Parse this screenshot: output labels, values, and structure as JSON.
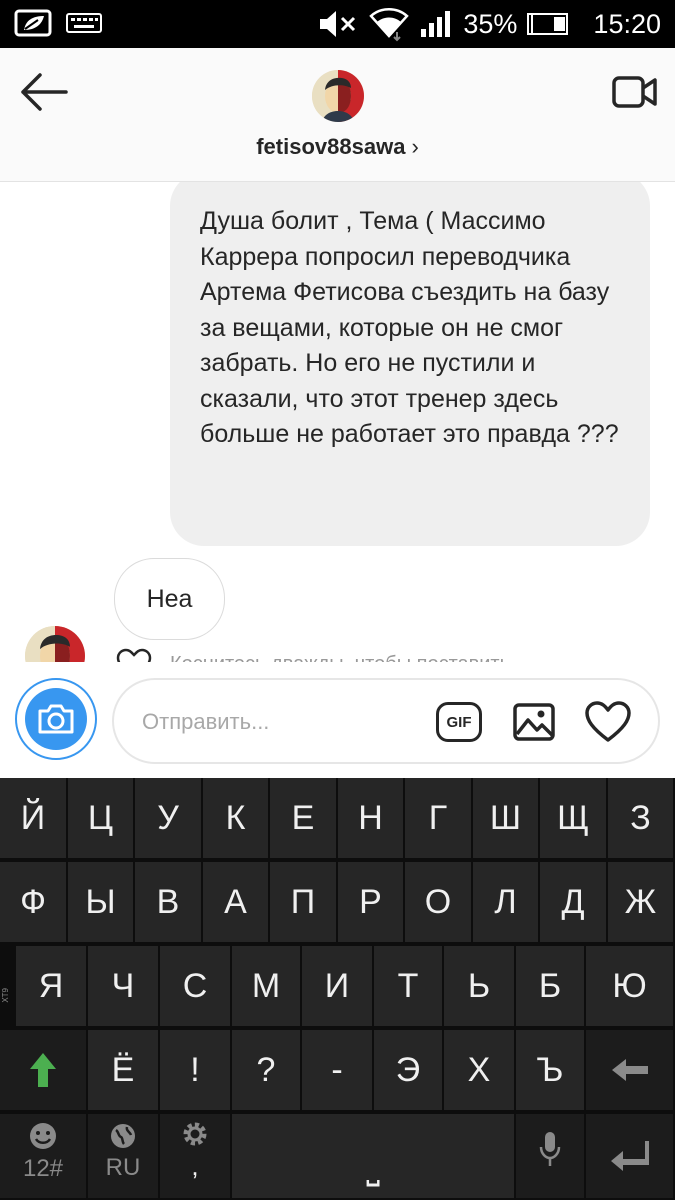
{
  "status_bar": {
    "battery_percent": "35%",
    "time": "15:20",
    "icons": [
      "leaf-screen-icon",
      "keyboard-icon",
      "mute-icon",
      "wifi-icon",
      "signal-icon",
      "battery-icon"
    ]
  },
  "header": {
    "username": "fetisov88sawa",
    "username_chevron": "›",
    "icons": [
      "back-arrow-icon",
      "video-call-icon"
    ]
  },
  "chat": {
    "outgoing_message": "Душа болит , Тема ( Массимо Каррера попросил переводчика Артема Фетисова съездить на базу за вещами, которые он не смог забрать. Но его не пустили и сказали, что этот тренер здесь больше не работает это правда ???",
    "incoming_message": "Неа",
    "like_hint": "Коснитесь дважды, чтобы поставить"
  },
  "composer": {
    "placeholder": "Отправить...",
    "gif_label": "GIF",
    "icons": [
      "camera-icon",
      "gallery-icon",
      "heart-icon"
    ]
  },
  "keyboard": {
    "side_label": "XT9",
    "row1": [
      "Й",
      "Ц",
      "У",
      "К",
      "Е",
      "Н",
      "Г",
      "Ш",
      "Щ",
      "З"
    ],
    "row2": [
      "Ф",
      "Ы",
      "В",
      "А",
      "П",
      "Р",
      "О",
      "Л",
      "Д",
      "Ж"
    ],
    "row3": [
      "Я",
      "Ч",
      "С",
      "М",
      "И",
      "Т",
      "Ь",
      "Б",
      "Ю"
    ],
    "row4": [
      "Ё",
      "!",
      "?",
      "-",
      "Э",
      "Х",
      "Ъ"
    ],
    "numbers_label": "12#",
    "language_label": "RU",
    "comma_label": ",",
    "space_label": "⎵",
    "colors": {
      "key_bg": "#262626",
      "shift_arrow": "#4caf50",
      "accent": "#3897f0"
    }
  }
}
